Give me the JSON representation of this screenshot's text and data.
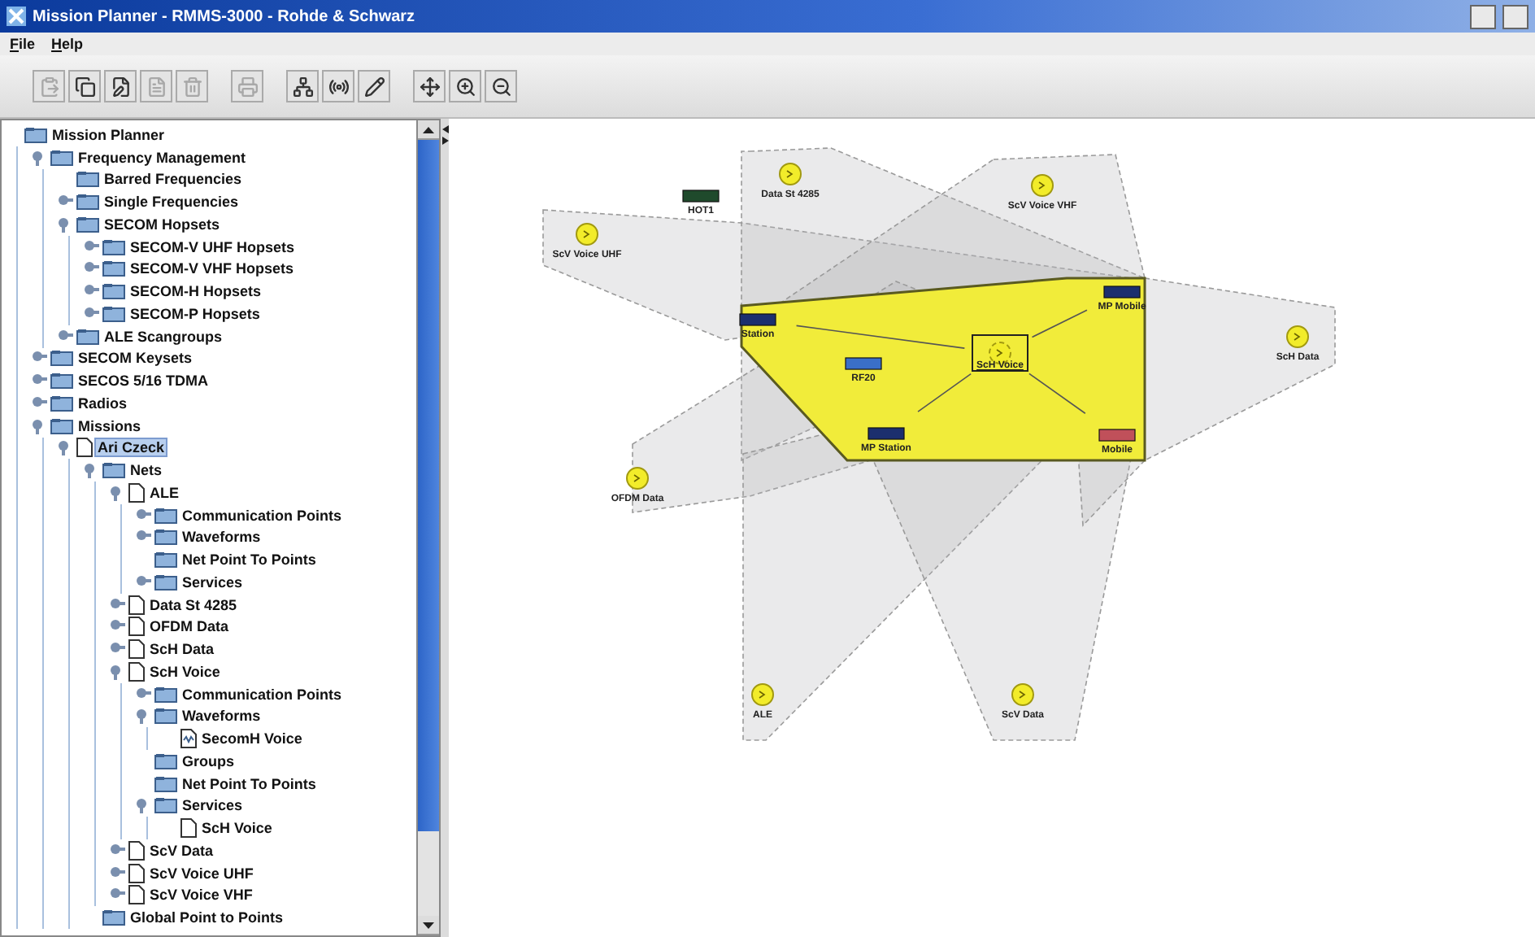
{
  "window": {
    "title": "Mission Planner - RMMS-3000 - Rohde & Schwarz"
  },
  "menu": [
    "File",
    "Help"
  ],
  "toolbar": [
    {
      "kind": "paste",
      "disabled": true
    },
    {
      "kind": "copy",
      "disabled": false
    },
    {
      "kind": "edit",
      "disabled": false
    },
    {
      "kind": "properties",
      "disabled": true
    },
    {
      "kind": "delete",
      "disabled": true
    },
    {
      "kind": "print",
      "disabled": true
    },
    {
      "kind": "network",
      "disabled": false
    },
    {
      "kind": "radio",
      "disabled": false
    },
    {
      "kind": "pencil",
      "disabled": false
    },
    {
      "kind": "move",
      "disabled": false
    },
    {
      "kind": "zoom-in",
      "disabled": false
    },
    {
      "kind": "zoom-out",
      "disabled": false
    }
  ],
  "tree": [
    {
      "label": "Mission Planner",
      "kind": "folder",
      "selected": false,
      "children": [
        {
          "label": "Frequency Management",
          "kind": "folder",
          "expanded": true,
          "selected": false,
          "children": [
            {
              "label": "Barred Frequencies",
              "kind": "folder",
              "selected": false
            },
            {
              "label": "Single Frequencies",
              "kind": "folder",
              "expanded": false,
              "selected": false
            },
            {
              "label": "SECOM Hopsets",
              "kind": "folder",
              "expanded": true,
              "selected": false,
              "children": [
                {
                  "label": "SECOM-V UHF Hopsets",
                  "kind": "folder",
                  "expanded": false,
                  "selected": false
                },
                {
                  "label": "SECOM-V VHF Hopsets",
                  "kind": "folder",
                  "expanded": false,
                  "selected": false
                },
                {
                  "label": "SECOM-H Hopsets",
                  "kind": "folder",
                  "expanded": false,
                  "selected": false
                },
                {
                  "label": "SECOM-P Hopsets",
                  "kind": "folder",
                  "expanded": false,
                  "selected": false
                }
              ]
            },
            {
              "label": "ALE Scangroups",
              "kind": "folder",
              "expanded": false,
              "selected": false
            }
          ]
        },
        {
          "label": "SECOM Keysets",
          "kind": "folder",
          "expanded": false,
          "selected": false
        },
        {
          "label": "SECOS 5/16 TDMA",
          "kind": "folder",
          "expanded": false,
          "selected": false
        },
        {
          "label": "Radios",
          "kind": "folder",
          "expanded": false,
          "selected": false
        },
        {
          "label": "Missions",
          "kind": "folder",
          "expanded": true,
          "selected": false,
          "children": [
            {
              "label": "Ari Czeck",
              "kind": "document",
              "expanded": true,
              "selected": true,
              "children": [
                {
                  "label": "Nets",
                  "kind": "folder",
                  "expanded": true,
                  "selected": false,
                  "children": [
                    {
                      "label": "ALE",
                      "kind": "document",
                      "expanded": true,
                      "selected": false,
                      "children": [
                        {
                          "label": "Communication Points",
                          "kind": "folder",
                          "expanded": false,
                          "selected": false
                        },
                        {
                          "label": "Waveforms",
                          "kind": "folder",
                          "expanded": false,
                          "selected": false
                        },
                        {
                          "label": "Net Point To Points",
                          "kind": "folder",
                          "selected": false
                        },
                        {
                          "label": "Services",
                          "kind": "folder",
                          "expanded": false,
                          "selected": false
                        }
                      ]
                    },
                    {
                      "label": "Data St 4285",
                      "kind": "document",
                      "expanded": false,
                      "selected": false
                    },
                    {
                      "label": "OFDM Data",
                      "kind": "document",
                      "expanded": false,
                      "selected": false
                    },
                    {
                      "label": "ScH Data",
                      "kind": "document",
                      "expanded": false,
                      "selected": false
                    },
                    {
                      "label": "ScH Voice",
                      "kind": "document",
                      "expanded": true,
                      "selected": false,
                      "children": [
                        {
                          "label": "Communication Points",
                          "kind": "folder",
                          "expanded": false,
                          "selected": false
                        },
                        {
                          "label": "Waveforms",
                          "kind": "folder",
                          "expanded": true,
                          "selected": false,
                          "children": [
                            {
                              "label": "SecomH Voice",
                              "kind": "waveform",
                              "selected": false
                            }
                          ]
                        },
                        {
                          "label": "Groups",
                          "kind": "folder",
                          "selected": false
                        },
                        {
                          "label": "Net Point To Points",
                          "kind": "folder",
                          "selected": false
                        },
                        {
                          "label": "Services",
                          "kind": "folder",
                          "expanded": true,
                          "selected": false,
                          "children": [
                            {
                              "label": "ScH Voice",
                              "kind": "document",
                              "selected": false
                            }
                          ]
                        }
                      ]
                    },
                    {
                      "label": "ScV Data",
                      "kind": "document",
                      "expanded": false,
                      "selected": false
                    },
                    {
                      "label": "ScV Voice UHF",
                      "kind": "document",
                      "expanded": false,
                      "selected": false
                    },
                    {
                      "label": "ScV Voice VHF",
                      "kind": "document",
                      "expanded": false,
                      "selected": false
                    }
                  ]
                },
                {
                  "label": "Global Point to Points",
                  "kind": "folder",
                  "selected": false
                }
              ]
            }
          ]
        }
      ]
    }
  ],
  "diagram": {
    "nodes": [
      {
        "label": "Data St 4285",
        "kind": "net",
        "selected": false
      },
      {
        "label": "ScV Voice VHF",
        "kind": "net",
        "selected": false
      },
      {
        "label": "ScV Voice UHF",
        "kind": "net",
        "selected": false
      },
      {
        "label": "HOT1",
        "kind": "radio",
        "color": "#1f4a2c"
      },
      {
        "label": "Station",
        "kind": "radio",
        "color": "#1c2f6e"
      },
      {
        "label": "RF20",
        "kind": "radio",
        "color": "#3a6fc8"
      },
      {
        "label": "ScH Voice",
        "kind": "net",
        "selected": true
      },
      {
        "label": "MP Mobile",
        "kind": "radio",
        "color": "#1c2f6e"
      },
      {
        "label": "ScH Data",
        "kind": "net",
        "selected": false
      },
      {
        "label": "OFDM Data",
        "kind": "net",
        "selected": false
      },
      {
        "label": "MP Station",
        "kind": "radio",
        "color": "#1c2f6e"
      },
      {
        "label": "Mobile",
        "kind": "radio",
        "color": "#c0505a"
      },
      {
        "label": "ALE",
        "kind": "net",
        "selected": false
      },
      {
        "label": "ScV Data",
        "kind": "net",
        "selected": false
      }
    ]
  }
}
